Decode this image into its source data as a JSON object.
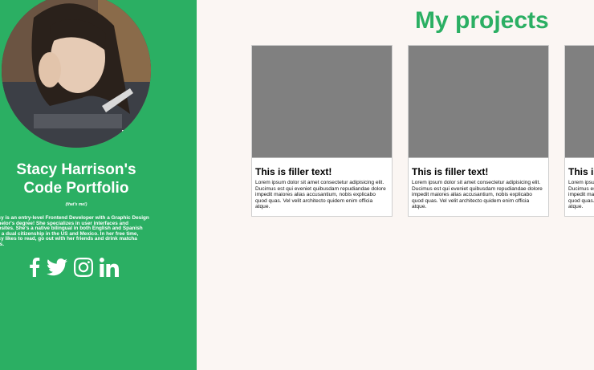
{
  "profile": {
    "name": "Stacy Harrison's Code Portfolio",
    "note": "(that's me!)",
    "bio": "acy is an entry-level Frontend Developer with a Graphic Design\nchelor's degree! She specializes in user interfaces and\nebsites. She's a native bilingual in both English and Spanish\nth a dual citizenship in the US and Mexico. In her free time,\nacy likes to read, go out with her friends and drink matcha\ntes."
  },
  "socials": [
    {
      "icon": "facebook-icon"
    },
    {
      "icon": "twitter-icon"
    },
    {
      "icon": "instagram-icon"
    },
    {
      "icon": "linkedin-icon"
    }
  ],
  "main": {
    "title": "My projects"
  },
  "projects": [
    {
      "title": "This is filler text!",
      "text": "Lorem ipsum dolor sit amet consectetur adipisicing elit. Ducimus est qui eveniet quibusdam repudiandae dolore impedit maiores alias accusantium, nobis explicabo quod quas. Vel velit architecto quidem enim officia atque."
    },
    {
      "title": "This is filler text!",
      "text": "Lorem ipsum dolor sit amet consectetur adipisicing elit. Ducimus est qui eveniet quibusdam repudiandae dolore impedit maiores alias accusantium, nobis explicabo quod quas. Vel velit architecto quidem enim officia atque."
    },
    {
      "title": "This is filler text!",
      "text": "Lorem ipsum dolor sit amet consectetur adipisicing elit. Ducimus est qui eveniet quibusdam repudiandae dolore impedit maiores alias accusantium, nobis explicabo quod quas. Vel velit architecto quidem enim officia atque."
    }
  ],
  "colors": {
    "accent": "#2baf63",
    "background": "#fbf6f3",
    "thumbnail": "#808080"
  }
}
